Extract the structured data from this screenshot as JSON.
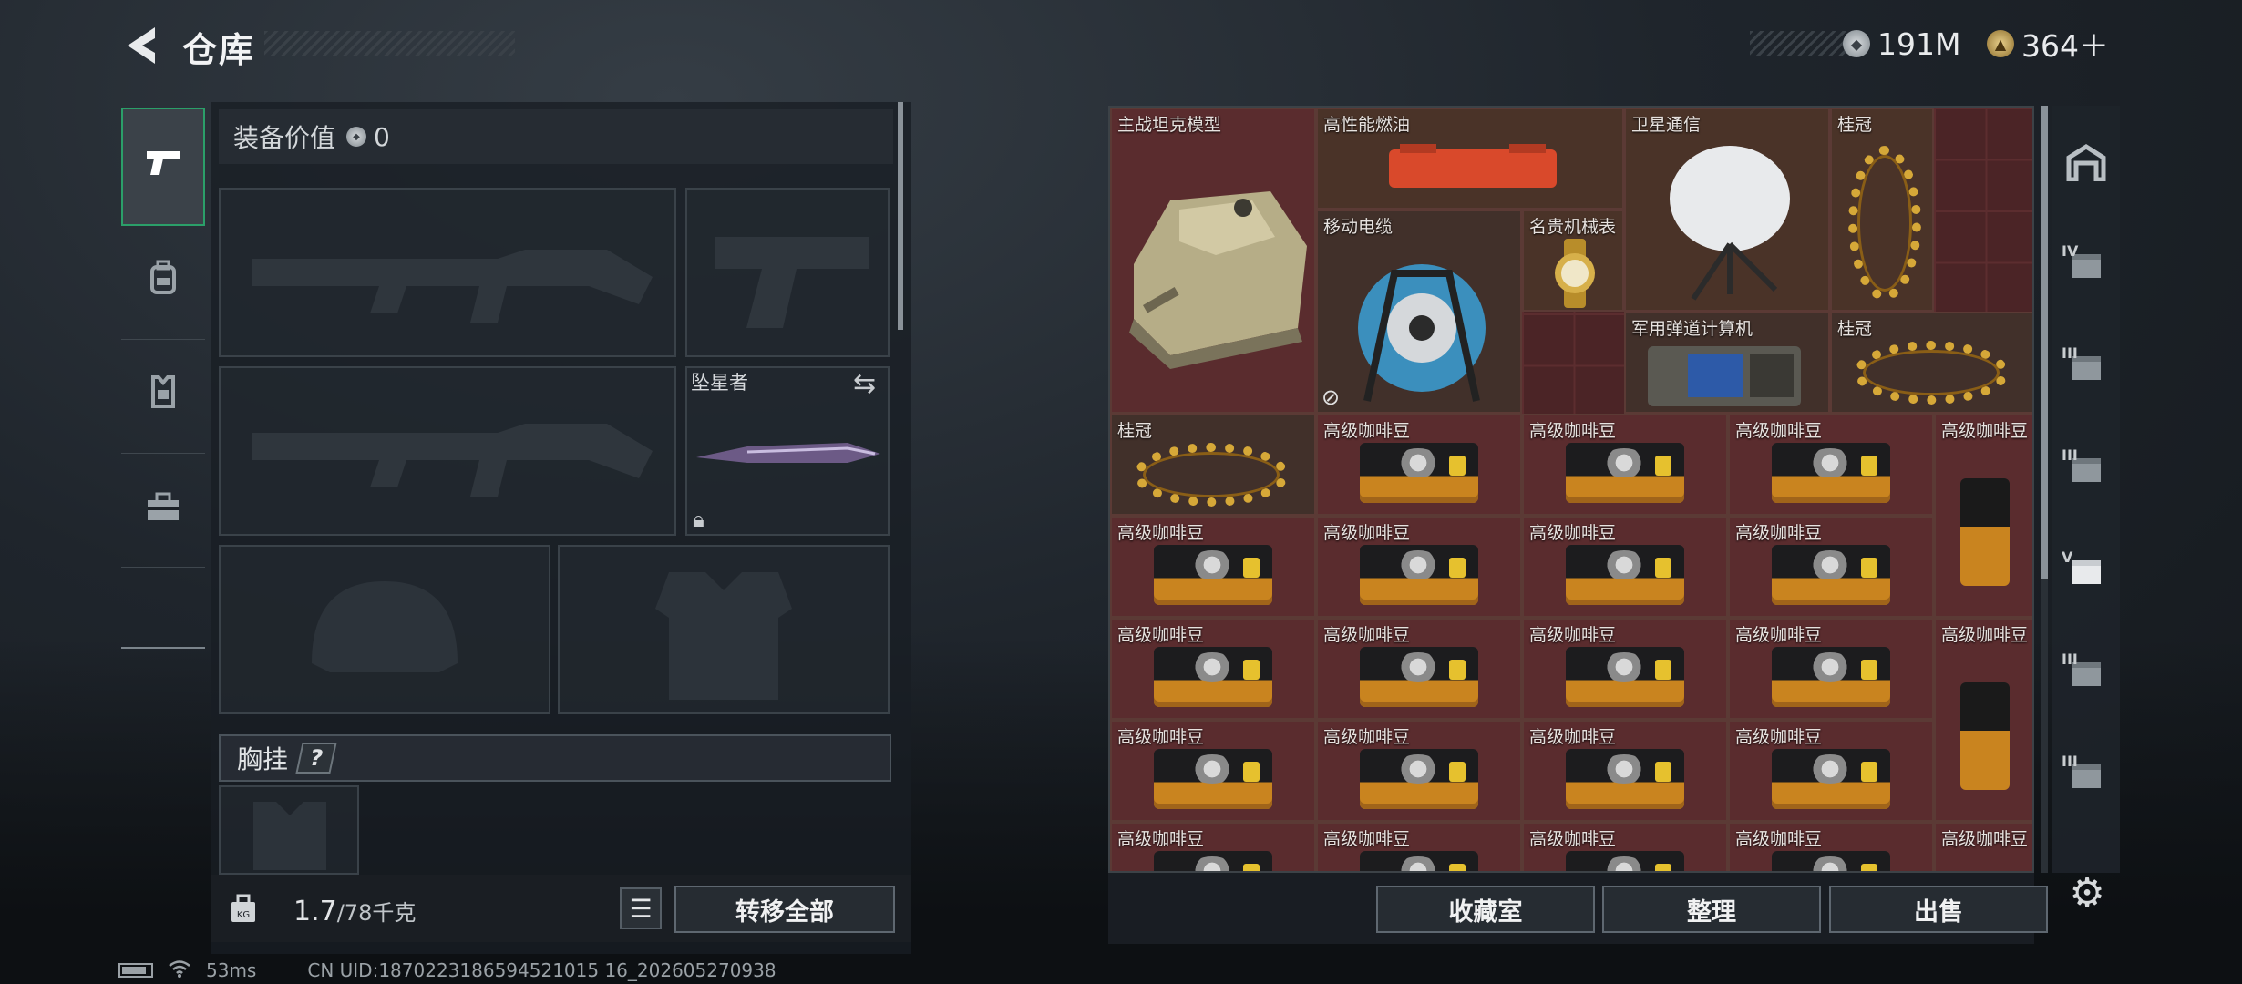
{
  "header": {
    "back_icon": "←",
    "title": "仓库"
  },
  "currency": {
    "silver": "191M",
    "gold": "364＋"
  },
  "left_tabs": [
    {
      "name": "weapons-tab",
      "icon": "pistol-icon",
      "active": true
    },
    {
      "name": "backpack-tab",
      "icon": "backpack-icon",
      "active": false
    },
    {
      "name": "vest-tab",
      "icon": "vest-icon",
      "active": false
    },
    {
      "name": "toolbox-tab",
      "icon": "toolbox-icon",
      "active": false
    }
  ],
  "loadout": {
    "equip_value_label": "装备价值",
    "equip_value": "0",
    "knife_name": "坠星者",
    "chest_label": "胸挂",
    "chest_help": "?"
  },
  "left_footer": {
    "weight": "1.7",
    "weight_max": "/78千克",
    "transfer_all": "转移全部"
  },
  "stash_items": {
    "tank": "主战坦克模型",
    "fuel": "高性能燃油",
    "satellite": "卫星通信",
    "crown": "桂冠",
    "cable": "移动电缆",
    "watch": "名贵机械表",
    "computer": "军用弹道计算机",
    "coffee": "高级咖啡豆"
  },
  "right_footer": {
    "vault": "收藏室",
    "sort": "整理",
    "sell": "出售"
  },
  "right_tabs": [
    {
      "label": "",
      "icon": "garage-icon"
    },
    {
      "label": "IV",
      "icon": "box-iv-icon"
    },
    {
      "label": "III",
      "icon": "box-iii-icon"
    },
    {
      "label": "III",
      "icon": "box-iii-icon"
    },
    {
      "label": "V",
      "icon": "box-v-icon"
    },
    {
      "label": "III",
      "icon": "box-iii-icon"
    },
    {
      "label": "III",
      "icon": "box-iii-icon"
    }
  ],
  "status": {
    "ping": "53ms",
    "uid": "CN UID:1870223186594521015 16_202605270938"
  },
  "colors": {
    "accent_green": "#2b9f69",
    "stash_bg": "#4b2426"
  }
}
